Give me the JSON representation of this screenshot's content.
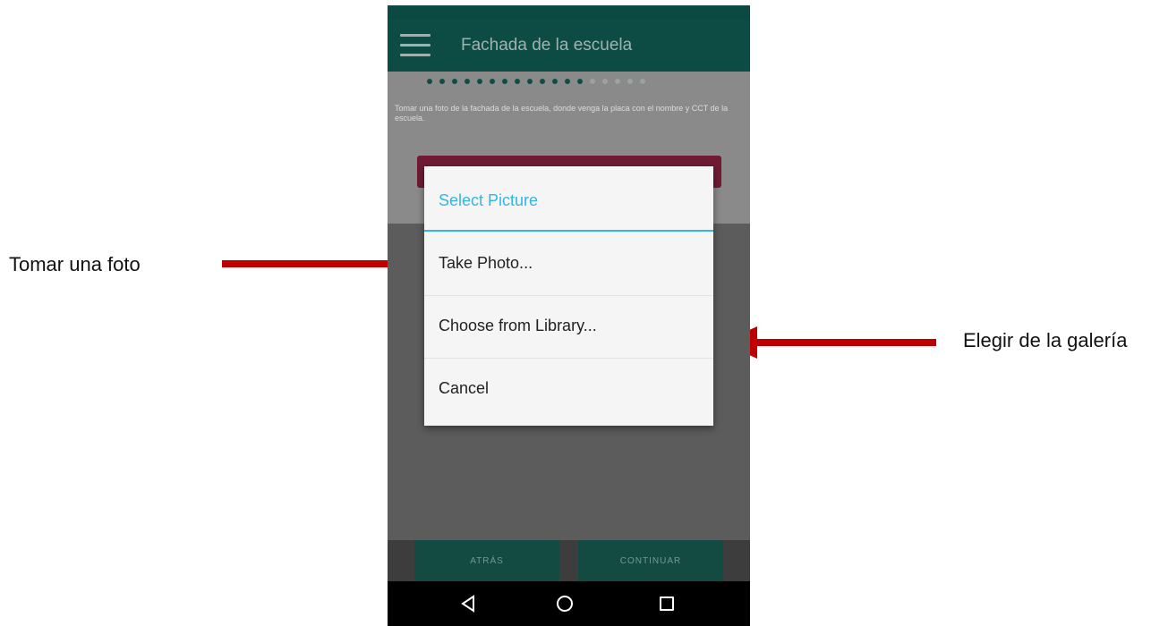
{
  "annotations": {
    "left_label": "Tomar una foto",
    "right_label": "Elegir de la galería",
    "arrow_color": "#c00000"
  },
  "app": {
    "title": "Fachada de la escuela",
    "menu_icon": "hamburger-menu-icon",
    "progress": {
      "steps_total": 18,
      "steps_done": 13
    },
    "instruction": "Tomar una foto de la fachada de la escuela, donde venga la placa con el nombre y CCT de la escuela.",
    "colors": {
      "appbar": "#0e5a50",
      "accent": "#33b5e5",
      "button": "#6e1b33"
    }
  },
  "dialog": {
    "title": "Select Picture",
    "options": [
      "Take Photo...",
      "Choose from Library...",
      "Cancel"
    ]
  },
  "footer": {
    "back_label": "ATRÁS",
    "next_label": "CONTINUAR"
  },
  "navbar": {
    "icons": [
      "back-triangle-icon",
      "home-circle-icon",
      "recents-square-icon"
    ]
  }
}
